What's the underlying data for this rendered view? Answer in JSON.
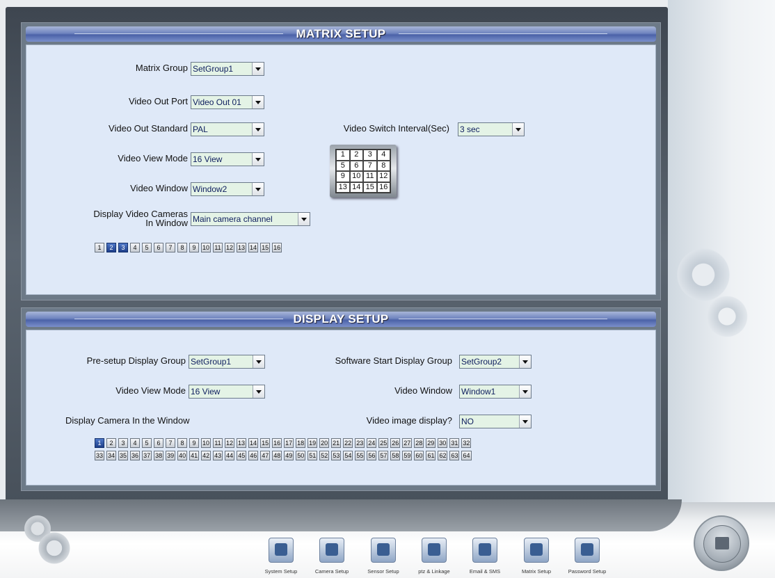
{
  "matrix": {
    "title": "MATRIX SETUP",
    "matrix_group": {
      "label": "Matrix Group",
      "value": "SetGroup1"
    },
    "video_out_port": {
      "label": "Video Out Port",
      "value": "Video Out 01"
    },
    "video_out_standard": {
      "label": "Video Out Standard",
      "value": "PAL"
    },
    "video_view_mode": {
      "label": "Video View Mode",
      "value": "16 View"
    },
    "video_window": {
      "label": "Video Window",
      "value": "Window2"
    },
    "display_cameras": {
      "label_line1": "Display Video Cameras",
      "label_line2": "In Window",
      "value": "Main camera channel"
    },
    "switch_interval": {
      "label": "Video Switch Interval(Sec)",
      "value": "3 sec"
    },
    "layout_grid": [
      "1",
      "2",
      "3",
      "4",
      "5",
      "6",
      "7",
      "8",
      "9",
      "10",
      "11",
      "12",
      "13",
      "14",
      "15",
      "16"
    ],
    "channels": [
      "1",
      "2",
      "3",
      "4",
      "5",
      "6",
      "7",
      "8",
      "9",
      "10",
      "11",
      "12",
      "13",
      "14",
      "15",
      "16"
    ],
    "selected_channels": [
      "2",
      "3"
    ]
  },
  "display": {
    "title": "DISPLAY SETUP",
    "pre_setup_group": {
      "label": "Pre-setup  Display Group",
      "value": "SetGroup1"
    },
    "software_start_group": {
      "label": "Software Start Display Group",
      "value": "SetGroup2"
    },
    "video_view_mode": {
      "label": "Video View Mode",
      "value": "16 View"
    },
    "video_window": {
      "label": "Video Window",
      "value": "Window1"
    },
    "camera_in_window_label": "Display Camera In the Window",
    "image_display": {
      "label": "Video image display?",
      "value": "NO"
    },
    "channels_row1": [
      "1",
      "2",
      "3",
      "4",
      "5",
      "6",
      "7",
      "8",
      "9",
      "10",
      "11",
      "12",
      "13",
      "14",
      "15",
      "16",
      "17",
      "18",
      "19",
      "20",
      "21",
      "22",
      "23",
      "24",
      "25",
      "26",
      "27",
      "28",
      "29",
      "30",
      "31",
      "32"
    ],
    "channels_row2": [
      "33",
      "34",
      "35",
      "36",
      "37",
      "38",
      "39",
      "40",
      "41",
      "42",
      "43",
      "44",
      "45",
      "46",
      "47",
      "48",
      "49",
      "50",
      "51",
      "52",
      "53",
      "54",
      "55",
      "56",
      "57",
      "58",
      "59",
      "60",
      "61",
      "62",
      "63",
      "64"
    ],
    "selected_channels": [
      "1"
    ]
  },
  "toolbar": [
    {
      "label": "System Setup",
      "icon": "system-setup-icon"
    },
    {
      "label": "Camera Setup",
      "icon": "camera-setup-icon"
    },
    {
      "label": "Sensor Setup",
      "icon": "sensor-setup-icon"
    },
    {
      "label": "ptz & Linkage",
      "icon": "ptz-linkage-icon"
    },
    {
      "label": "Email & SMS",
      "icon": "email-sms-icon"
    },
    {
      "label": "Matrix Setup",
      "icon": "matrix-setup-icon"
    },
    {
      "label": "Password Setup",
      "icon": "password-setup-icon"
    }
  ]
}
